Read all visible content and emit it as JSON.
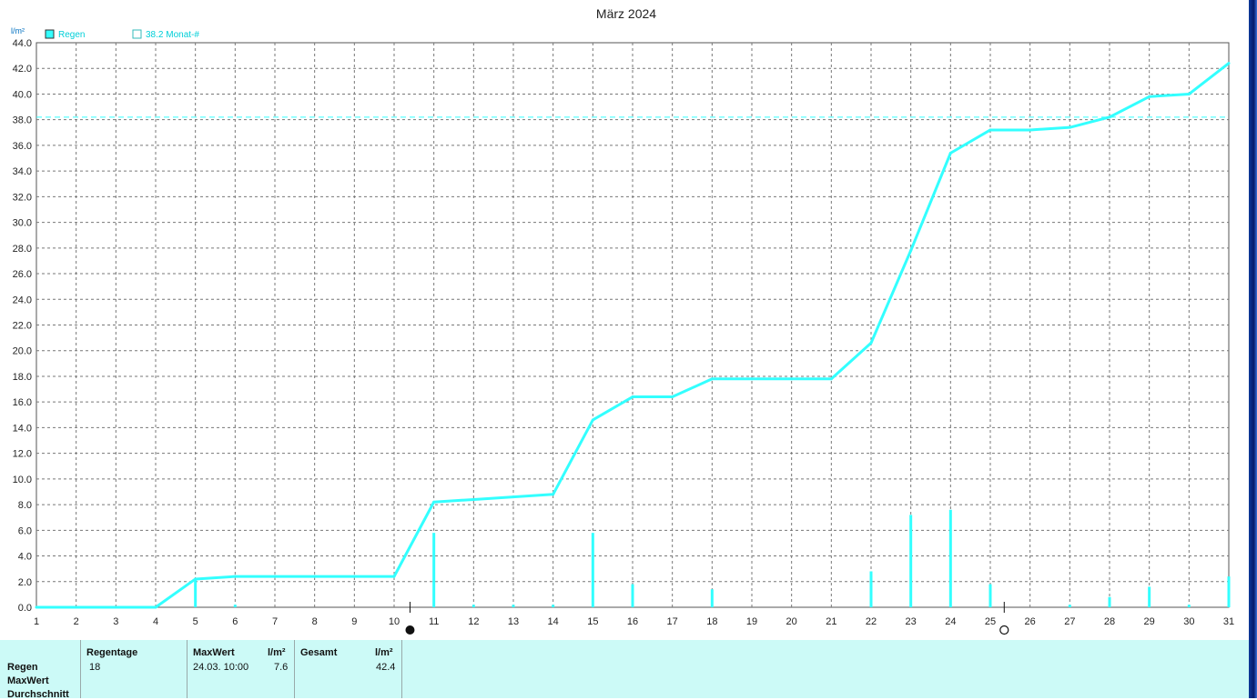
{
  "chart_data": {
    "type": "line",
    "title": "März 2024",
    "ylabel": "l/m²",
    "xlabel": "",
    "ylim": [
      0,
      44
    ],
    "xlim": [
      1,
      31
    ],
    "grid": true,
    "legend_placement": "top-left",
    "y_ticks": [
      "0.0",
      "2.0",
      "4.0",
      "6.0",
      "8.0",
      "10.0",
      "12.0",
      "14.0",
      "16.0",
      "18.0",
      "20.0",
      "22.0",
      "24.0",
      "26.0",
      "28.0",
      "30.0",
      "32.0",
      "34.0",
      "36.0",
      "38.0",
      "40.0",
      "42.0",
      "44.0"
    ],
    "x_ticks": [
      "1",
      "2",
      "3",
      "4",
      "5",
      "6",
      "7",
      "8",
      "9",
      "10",
      "11",
      "12",
      "13",
      "14",
      "15",
      "16",
      "17",
      "18",
      "19",
      "20",
      "21",
      "22",
      "23",
      "24",
      "25",
      "26",
      "27",
      "28",
      "29",
      "30",
      "31"
    ],
    "series": [
      {
        "name": "Regen",
        "x": [
          1,
          2,
          3,
          4,
          5,
          6,
          7,
          8,
          9,
          10,
          11,
          12,
          13,
          14,
          15,
          16,
          17,
          18,
          19,
          20,
          21,
          22,
          23,
          24,
          25,
          26,
          27,
          28,
          29,
          30,
          31
        ],
        "values": [
          0,
          0,
          0,
          0,
          2.2,
          2.4,
          2.4,
          2.4,
          2.4,
          2.4,
          8.2,
          8.4,
          8.6,
          8.8,
          14.6,
          16.4,
          16.4,
          17.8,
          17.8,
          17.8,
          17.8,
          20.6,
          27.8,
          35.4,
          37.2,
          37.2,
          37.4,
          38.2,
          39.8,
          40.0,
          42.4
        ]
      }
    ],
    "daily_bars": {
      "x": [
        5,
        6,
        11,
        12,
        13,
        14,
        15,
        16,
        18,
        22,
        23,
        24,
        25,
        27,
        28,
        29,
        30,
        31
      ],
      "values": [
        2.2,
        0.2,
        5.8,
        0.2,
        0.2,
        0.2,
        5.8,
        1.8,
        1.4,
        2.8,
        7.2,
        7.6,
        1.8,
        0.2,
        0.8,
        1.6,
        0.2,
        2.4
      ]
    },
    "reference_line": {
      "label": "38.2 Monat-#",
      "value": 38.2
    },
    "moon_phases": [
      {
        "day": 10.4,
        "phase": "new"
      },
      {
        "day": 25.35,
        "phase": "full"
      }
    ],
    "colors": {
      "series": "#33ffff",
      "bars": "#33ffff",
      "reference": "#33ffff",
      "grid": "#777777"
    }
  },
  "summary": {
    "row_labels": [
      "Regen",
      "MaxWert",
      "Durchschnitt"
    ],
    "regentage_header": "Regentage",
    "regentage_value": "18",
    "maxwert_header": "MaxWert",
    "maxwert_unit": "l/m²",
    "maxwert_date": "24.03.  10:00",
    "maxwert_value": "7.6",
    "gesamt_header": "Gesamt",
    "gesamt_unit": "l/m²",
    "gesamt_value": "42.4"
  }
}
